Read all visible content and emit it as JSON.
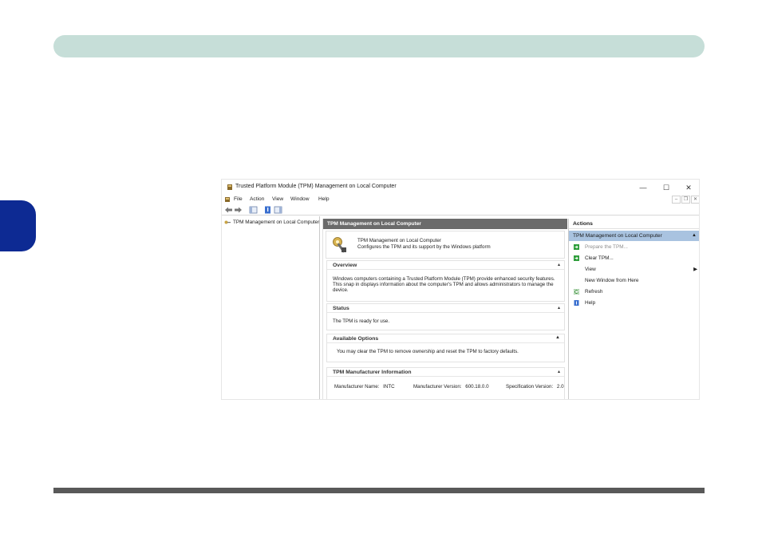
{
  "window": {
    "title": "Trusted Platform Module (TPM) Management on Local Computer",
    "minimize": "—",
    "maximize": "☐",
    "close": "✕"
  },
  "menu": {
    "items": [
      "File",
      "Action",
      "View",
      "Window",
      "Help"
    ],
    "mdi_minimize": "–",
    "mdi_restore": "❐",
    "mdi_close": "✕"
  },
  "tree": {
    "root_label": "TPM Management on Local Computer"
  },
  "center": {
    "header": "TPM Management on Local Computer",
    "intro_title": "TPM Management on Local Computer",
    "intro_desc": "Configures the TPM and its support by the Windows platform",
    "overview": {
      "title": "Overview",
      "toggle": "▴",
      "line1": "Windows computers containing a Trusted Platform Module (TPM) provide enhanced security features.",
      "line2": "This snap in displays information about the computer's TPM and allows administrators to manage the",
      "line3": "device."
    },
    "status": {
      "title": "Status",
      "toggle": "▴",
      "text": "The TPM is ready for use."
    },
    "options": {
      "title": "Available Options",
      "toggle": "▲",
      "text": "You may clear the TPM to remove ownership and reset the TPM to factory defaults."
    },
    "manufacturer": {
      "title": "TPM Manufacturer Information",
      "toggle": "▴",
      "name_label": "Manufacturer Name:",
      "name_value": "INTC",
      "version_label": "Manufacturer Version:",
      "version_value": "600.18.0.0",
      "spec_label": "Specification Version:",
      "spec_value": "2.0"
    }
  },
  "actions": {
    "header": "Actions",
    "group": "TPM Management on Local Computer",
    "group_toggle": "▲",
    "items": [
      {
        "label": "Prepare the TPM...",
        "icon": "green-arrow-icon"
      },
      {
        "label": "Clear TPM...",
        "icon": "green-arrow-icon"
      },
      {
        "label": "View",
        "icon": "none"
      },
      {
        "label": "New Window from Here",
        "icon": "none"
      },
      {
        "label": "Refresh",
        "icon": "refresh-icon"
      },
      {
        "label": "Help",
        "icon": "help-icon"
      }
    ],
    "view_arrow": "▶"
  },
  "colors": {
    "header_bar": "#c6ded8",
    "side_tab": "#0d2a93",
    "footer_line": "#595959",
    "center_header": "#6b6b6b",
    "actions_group": "#a9c3e0"
  }
}
